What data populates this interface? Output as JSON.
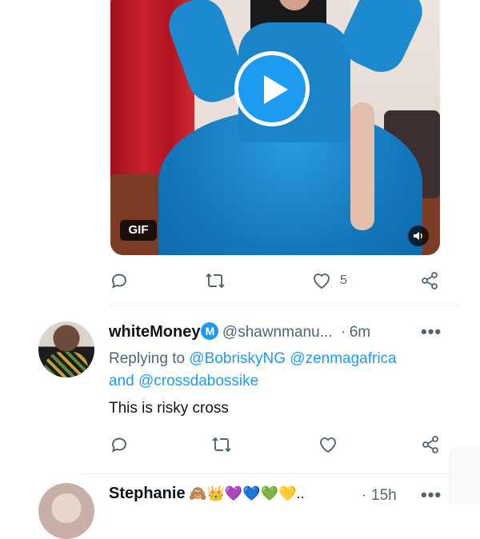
{
  "tweet1": {
    "media": {
      "badge": "GIF",
      "play_icon": "play-icon",
      "volume_icon": "volume-icon"
    },
    "actions": {
      "reply_icon": "reply-icon",
      "retweet_icon": "retweet-icon",
      "like_icon": "heart-icon",
      "like_count": "5",
      "share_icon": "share-icon"
    }
  },
  "tweet2": {
    "display_name": "whiteMoney",
    "badge_icon": "M",
    "handle": "@shawnmanu...",
    "separator": "·",
    "time": "6m",
    "more_icon": "•••",
    "replying_prefix": "Replying to",
    "mention1": "@BobriskyNG",
    "mention2": "@zenmagafrica",
    "and_text": "and",
    "mention3": "@crossdabossike",
    "text": "This is risky cross",
    "actions": {
      "reply_icon": "reply-icon",
      "retweet_icon": "retweet-icon",
      "like_icon": "heart-icon",
      "share_icon": "share-icon"
    }
  },
  "tweet3": {
    "display_name": "Stephanie",
    "emojis": "🙈👑💜💙💚💛..",
    "separator": "·",
    "time": "15h",
    "more_icon": "•••"
  },
  "colors": {
    "accent": "#1d9bf0",
    "text": "#0f1419",
    "muted": "#536471"
  }
}
